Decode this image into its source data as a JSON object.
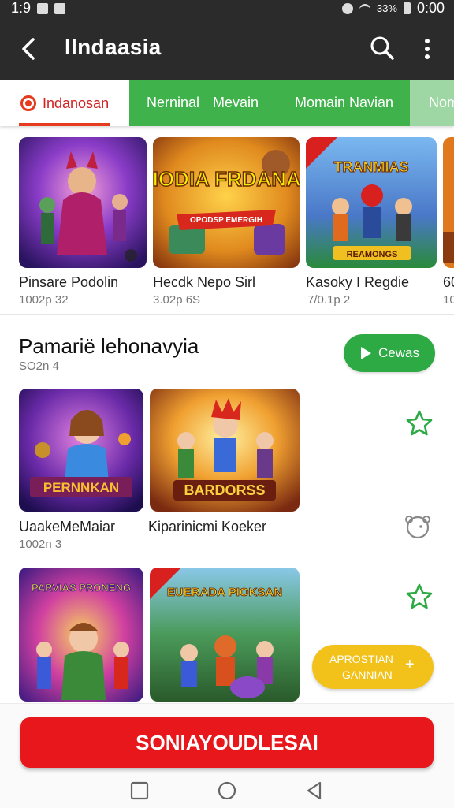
{
  "status_bar": {
    "time_left": "1:9",
    "time_right": "0:00",
    "signal_text": "33%"
  },
  "app_bar": {
    "title": "Ilndaasia"
  },
  "tabs": [
    {
      "label": "Indanosan"
    },
    {
      "label": "Nerninal"
    },
    {
      "label": "Mevain"
    },
    {
      "label": "Momain Navian"
    },
    {
      "label": "Nom"
    }
  ],
  "carousel": [
    {
      "title": "Pinsare Podolin",
      "sub": "1002p 32",
      "art_text": ""
    },
    {
      "title": "Hecdk Nepo Sirl",
      "sub": "3.02p 6S",
      "art_text": "HIODIA FRDANAS",
      "art_banner": "OPODSP EMERGIH"
    },
    {
      "title": "Kasoky I Regdie",
      "sub": "7/0.1p 2",
      "art_text": "TRANMIAS",
      "art_banner": "REAMONGS"
    },
    {
      "title": "60",
      "sub": "10"
    }
  ],
  "section": {
    "title": "Pamarië lehonavyia",
    "subtitle": "SO2n 4",
    "button_label": "Cewas"
  },
  "grid_rows": [
    {
      "items": [
        {
          "title": "UaakeMeMaiar",
          "sub": "1002n 3",
          "art_text": "PERNNKAN"
        },
        {
          "title": "Kiparinicmi Koeker",
          "sub": "",
          "art_text": "BARDORSS"
        }
      ]
    },
    {
      "items": [
        {
          "title": "",
          "sub": "",
          "art_text": "PARVIAS PRONENG"
        },
        {
          "title": "",
          "sub": "",
          "art_text": "EUERADA PIOKSAN"
        }
      ]
    }
  ],
  "fab": {
    "line1": "APROSTIAN",
    "line2": "GANNIAN",
    "plus": "+"
  },
  "cta": {
    "label": "SONIAYOUDLESAI"
  },
  "colors": {
    "primary_green": "#3fb24b",
    "cta_red": "#e8171c",
    "accent_yellow": "#f2c21a",
    "appbar_dark": "#2b2b2b"
  }
}
